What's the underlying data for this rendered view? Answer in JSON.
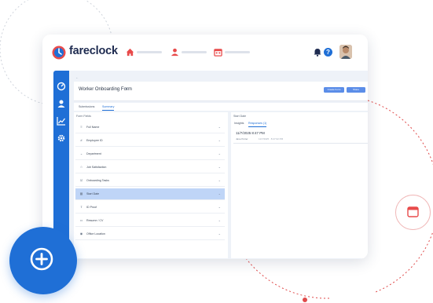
{
  "colors": {
    "accent": "#1f6fd6",
    "nav_icon": "#e84b4b",
    "deco_dots": "#e04a4a"
  },
  "app": {
    "name": "fareclock"
  },
  "nav": {
    "icons": [
      "home-icon",
      "user-icon",
      "calendar-icon"
    ]
  },
  "header_icons": [
    "bell-icon",
    "help-icon",
    "avatar"
  ],
  "sidebar_icons": [
    "dashboard-icon",
    "user-icon",
    "chart-icon",
    "gear-icon"
  ],
  "form": {
    "title": "Worker Onboarding Form",
    "buttons": [
      "Create Form",
      "Share"
    ],
    "tabs": [
      "Submissions",
      "Summary"
    ],
    "active_tab": "Summary",
    "fields_label": "Form Fields",
    "fields": [
      {
        "label": "Full Name",
        "icon": "text-icon"
      },
      {
        "label": "Employee ID",
        "icon": "id-icon"
      },
      {
        "label": "Department",
        "icon": "dropdown-icon"
      },
      {
        "label": "Job Satisfaction",
        "icon": "rating-icon"
      },
      {
        "label": "Onboarding Tasks",
        "icon": "checklist-icon"
      },
      {
        "label": "Start Date",
        "icon": "calendar-icon",
        "selected": true
      },
      {
        "label": "ID Proof",
        "icon": "upload-icon"
      },
      {
        "label": "Resume / CV",
        "icon": "document-icon"
      },
      {
        "label": "Office Location",
        "icon": "location-icon"
      }
    ]
  },
  "responses": {
    "label": "Start Date",
    "tabs": [
      "Insights",
      "Responses (1)"
    ],
    "active_tab": "Responses (1)",
    "entry": {
      "time": "11/7/2025 8:47 PM",
      "name": "Jane Porter",
      "tag": "11/7/2025 · 8:47:02 PM"
    }
  },
  "fab": {
    "icon": "plus-circle-icon"
  },
  "float_button": {
    "icon": "window-icon"
  }
}
